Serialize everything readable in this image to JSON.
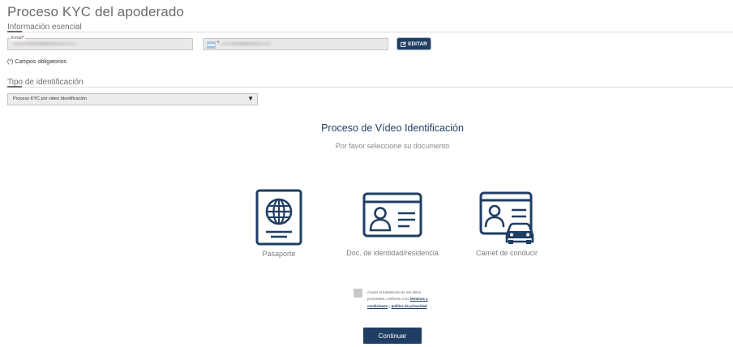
{
  "page": {
    "title": "Proceso KYC del apoderado"
  },
  "essential_info": {
    "heading": "Información esencial",
    "email": {
      "label": "Email",
      "required_marker": "*"
    },
    "phone": {
      "flag_icon": "flag-argentina-icon",
      "prefix": "+"
    },
    "edit_button": {
      "icon": "edit-icon",
      "label": "EDITAR"
    },
    "required_note": "(*) Campos obligatorios"
  },
  "identification": {
    "heading": "Tipo de identificación",
    "select": {
      "value": "Proceso KYC por video Identificación"
    }
  },
  "video_id": {
    "title": "Proceso de Vídeo Identificación",
    "subtitle": "Por favor seleccione su documento",
    "documents": [
      {
        "label": "Pasaporte",
        "icon": "passport-icon"
      },
      {
        "label": "Doc. de identidad/residencia",
        "icon": "id-card-icon"
      },
      {
        "label": "Carnet de conducir",
        "icon": "driver-license-icon"
      }
    ]
  },
  "consent": {
    "text_before": "Acepto el tratamiento de mis datos personales, conforme a los",
    "terms_link": "términos y condiciones",
    "connector": "y",
    "privacy_link": "política de privacidad"
  },
  "actions": {
    "continue_label": "Continuar"
  },
  "colors": {
    "primary": "#1f3e64",
    "required": "#d0021b",
    "field_bg": "#e9e9e9"
  }
}
